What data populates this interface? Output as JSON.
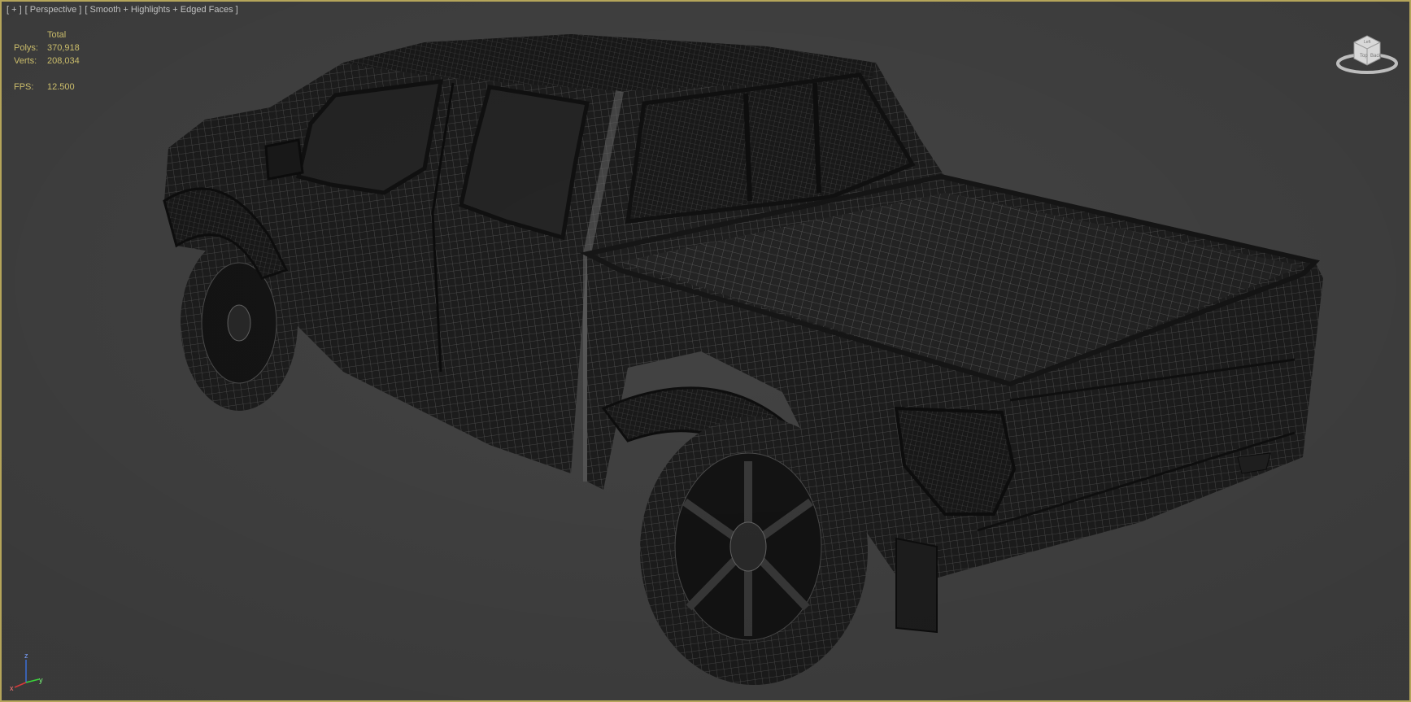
{
  "viewport": {
    "menu_label": "[ + ]",
    "view_label": "[ Perspective ]",
    "shading_label": "[ Smooth + Highlights + Edged Faces ]"
  },
  "stats": {
    "header": "Total",
    "polys_label": "Polys:",
    "polys_value": "370,918",
    "verts_label": "Verts:",
    "verts_value": "208,034",
    "fps_label": "FPS:",
    "fps_value": "12.500"
  },
  "viewcube": {
    "face_left": "Top",
    "face_right": "Back",
    "face_top": "Left"
  },
  "axes": {
    "x": "x",
    "y": "y",
    "z": "z"
  },
  "colors": {
    "background": "#444444",
    "border": "#b5a55a",
    "stats_text": "#e8d87a",
    "label_text": "#dcdcdc",
    "mesh_dark": "#1c1c1c",
    "wire": "#5a5a5a"
  }
}
